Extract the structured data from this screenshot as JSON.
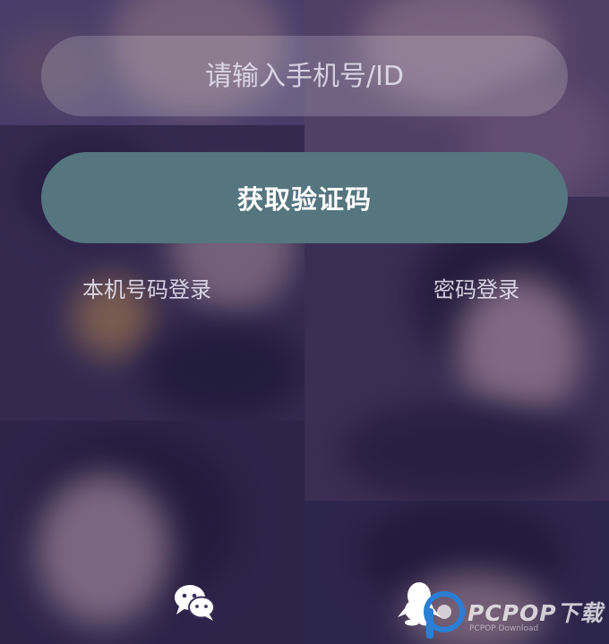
{
  "login": {
    "phone_placeholder": "请输入手机号/ID",
    "get_code_label": "获取验证码",
    "local_number_login_label": "本机号码登录",
    "password_login_label": "密码登录"
  },
  "social": {
    "wechat_icon": "wechat-icon",
    "qq_icon": "qq-icon"
  },
  "watermark": {
    "brand": "PCPOP下载",
    "sub": "PCPOP Download"
  },
  "colors": {
    "button": "#55757f",
    "overlay": "#30245c"
  }
}
